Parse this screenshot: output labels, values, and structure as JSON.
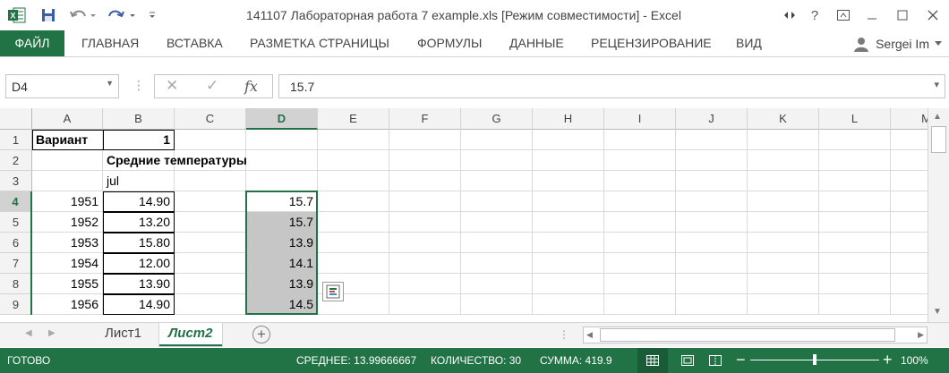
{
  "title_bar": {
    "title": "141107 Лабораторная работа 7 example.xls  [Режим совместимости] - Excel"
  },
  "ribbon": {
    "tabs": [
      "ФАЙЛ",
      "ГЛАВНАЯ",
      "ВСТАВКА",
      "РАЗМЕТКА СТРАНИЦЫ",
      "ФОРМУЛЫ",
      "ДАННЫЕ",
      "РЕЦЕНЗИРОВАНИЕ",
      "ВИД"
    ],
    "user": "Sergei Im"
  },
  "formula_bar": {
    "name_box": "D4",
    "fx_label": "fx",
    "value": "15.7"
  },
  "sheet": {
    "columns": [
      "A",
      "B",
      "C",
      "D",
      "E",
      "F",
      "G",
      "H",
      "I",
      "J",
      "K",
      "L",
      "M"
    ],
    "rows": [
      "1",
      "2",
      "3",
      "4",
      "5",
      "6",
      "7",
      "8",
      "9"
    ],
    "cells": {
      "A1": "Вариант",
      "B1": "1",
      "B2": "Средние температуры",
      "B3": "jul",
      "A4": "1951",
      "B4": "14.90",
      "D4": "15.7",
      "A5": "1952",
      "B5": "13.20",
      "D5": "15.7",
      "A6": "1953",
      "B6": "15.80",
      "D6": "13.9",
      "A7": "1954",
      "B7": "12.00",
      "D7": "14.1",
      "A8": "1955",
      "B8": "13.90",
      "D8": "13.9",
      "A9": "1956",
      "B9": "14.90",
      "D9": "14.5"
    },
    "selected_cell": "D4"
  },
  "sheet_tabs": {
    "tabs": [
      "Лист1",
      "Лист2"
    ],
    "active": "Лист2"
  },
  "status_bar": {
    "ready": "ГОТОВО",
    "average": "СРЕДНЕЕ: 13.99666667",
    "count": "КОЛИЧЕСТВО: 30",
    "sum": "СУММА: 419.9",
    "zoom": "100%"
  },
  "colors": {
    "accent": "#217346",
    "selection_shade": "#c6c6c6"
  }
}
